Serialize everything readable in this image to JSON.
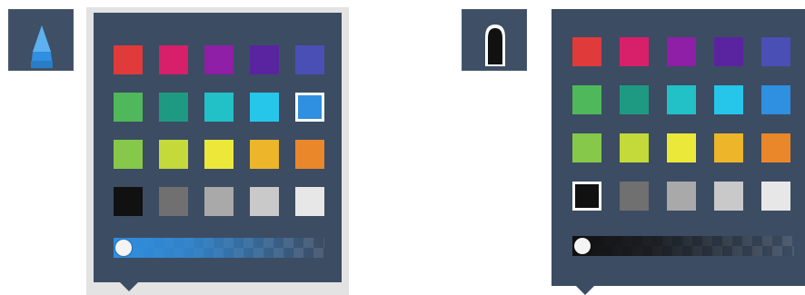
{
  "pickers": [
    {
      "pen_icon": "highlighter-pen-icon",
      "pen_color": "#2f8fe0",
      "selected_index": 9,
      "thickness": 0.0,
      "slider_color": "#2f8fe0"
    },
    {
      "pen_icon": "felt-tip-pen-icon",
      "pen_color": "#111111",
      "selected_index": 15,
      "thickness": 0.0,
      "slider_color": "#111111"
    }
  ],
  "colors": [
    "#e03a3a",
    "#d81f6a",
    "#8e1fa6",
    "#5a24a0",
    "#4a4fb6",
    "#4fb85a",
    "#1f9a82",
    "#22c1c8",
    "#26c6ea",
    "#2f8fe0",
    "#86c84a",
    "#c4d93a",
    "#ece83a",
    "#ecb52a",
    "#e9872a",
    "#111111",
    "#707070",
    "#a9a9a9",
    "#c9c9c9",
    "#e7e7e7"
  ],
  "color_names": [
    "red",
    "crimson",
    "purple",
    "violet",
    "indigo",
    "green",
    "teal",
    "turquoise",
    "sky",
    "blue",
    "lime",
    "yellow-green",
    "yellow",
    "gold",
    "orange",
    "black",
    "dark-gray",
    "gray",
    "light-gray",
    "white"
  ]
}
